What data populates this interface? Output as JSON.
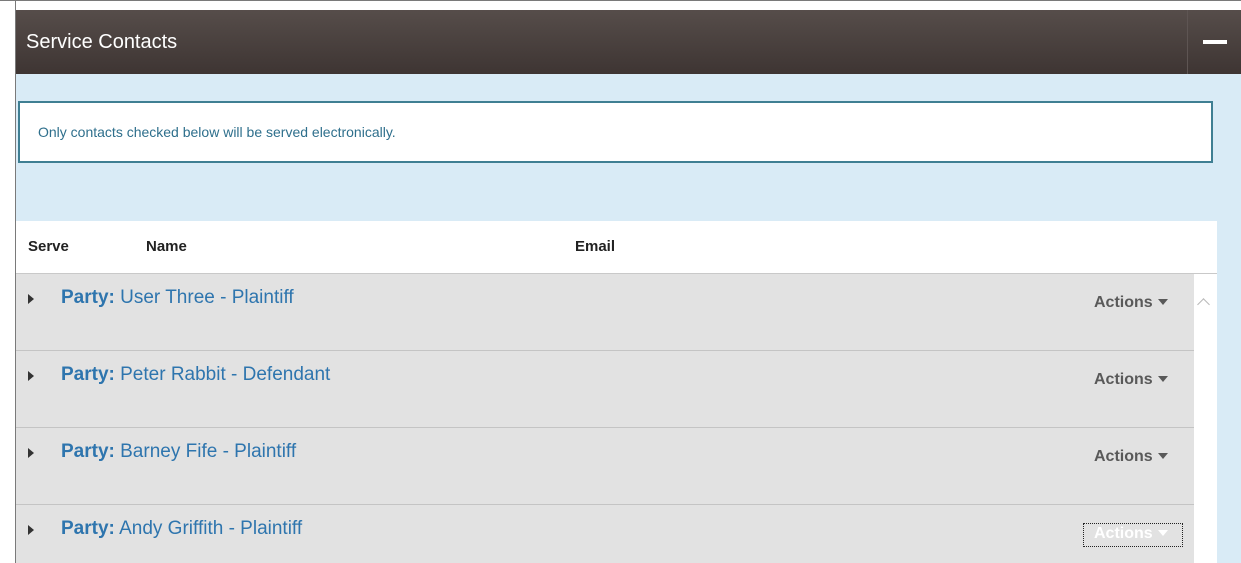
{
  "panel": {
    "title": "Service Contacts"
  },
  "notice": {
    "text": "Only contacts checked below will be served electronically."
  },
  "table": {
    "headers": {
      "serve": "Serve",
      "name": "Name",
      "email": "Email"
    },
    "rows": [
      {
        "label": "Party:",
        "title": " User Three - Plaintiff",
        "actions": "Actions"
      },
      {
        "label": "Party:",
        "title": " Peter Rabbit - Defendant",
        "actions": "Actions"
      },
      {
        "label": "Party:",
        "title": " Barney Fife - Plaintiff",
        "actions": "Actions"
      },
      {
        "label": "Party:",
        "title": " Andy Griffith - Plaintiff",
        "actions": "Actions"
      }
    ]
  },
  "colors": {
    "header_bg": "#463d3b",
    "body_bg": "#d9ebf6",
    "notice_border": "#3f7f93",
    "link_blue": "#2e75ae",
    "row_bg": "#e2e2e2"
  },
  "icons": {
    "collapse": "minus-icon",
    "row_expand": "caret-right-icon",
    "actions_dropdown": "caret-down-icon",
    "scroll_up": "chevron-up-icon"
  }
}
